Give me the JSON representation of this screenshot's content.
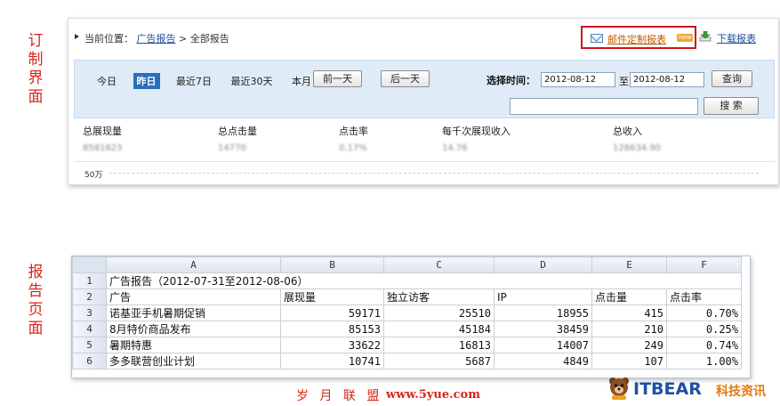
{
  "labels": {
    "top": "订制界面",
    "bottom": "报告页面"
  },
  "breadcrumb": {
    "prefix": "当前位置：",
    "link": "广告报告",
    "current": "> 全部报告"
  },
  "actions": {
    "mail": "邮件定制报表",
    "badge": "new",
    "download": "下载报表"
  },
  "date_tabs": [
    "今日",
    "昨日",
    "最近7日",
    "最近30天",
    "本月"
  ],
  "date_tab_active_index": 1,
  "buttons": {
    "prev_day": "前一天",
    "next_day": "后一天",
    "query": "查询",
    "search": "搜 索"
  },
  "time_filter": {
    "label": "选择时间：",
    "from": "2012-08-12",
    "to_label": "至",
    "to": "2012-08-12"
  },
  "stats": [
    {
      "label": "总展现量",
      "value": "8581623"
    },
    {
      "label": "总点击量",
      "value": "14770"
    },
    {
      "label": "点击率",
      "value": "0.17%"
    },
    {
      "label": "每千次展现收入",
      "value": "14.76"
    },
    {
      "label": "总收入",
      "value": "126634.90"
    }
  ],
  "chart_axis_label": "50万",
  "sheet": {
    "columns": [
      "A",
      "B",
      "C",
      "D",
      "E",
      "F"
    ],
    "row_numbers": [
      "1",
      "2",
      "3",
      "4",
      "5",
      "6"
    ],
    "title": "广告报告（2012-07-31至2012-08-06）",
    "headers": [
      "广告",
      "展现量",
      "独立访客",
      "IP",
      "点击量",
      "点击率"
    ],
    "rows": [
      [
        "诺基亚手机暑期促销",
        "59171",
        "25510",
        "18955",
        "415",
        "0.70%"
      ],
      [
        "8月特价商品发布",
        "85153",
        "45184",
        "38459",
        "210",
        "0.25%"
      ],
      [
        "暑期特惠",
        "33622",
        "16813",
        "14007",
        "249",
        "0.74%"
      ],
      [
        "多多联营创业计划",
        "10741",
        "5687",
        "4849",
        "107",
        "1.00%"
      ]
    ]
  },
  "footer": {
    "watermark": "岁 月 联 盟",
    "url": "www.5yue.com",
    "logo": "ITBEAR",
    "logo_cn": "科技资讯"
  },
  "colors": {
    "accent_red": "#c8161d",
    "link_blue": "#1a4e9c",
    "band_blue": "#dfecf8",
    "active_tab": "#2a6ebd"
  }
}
